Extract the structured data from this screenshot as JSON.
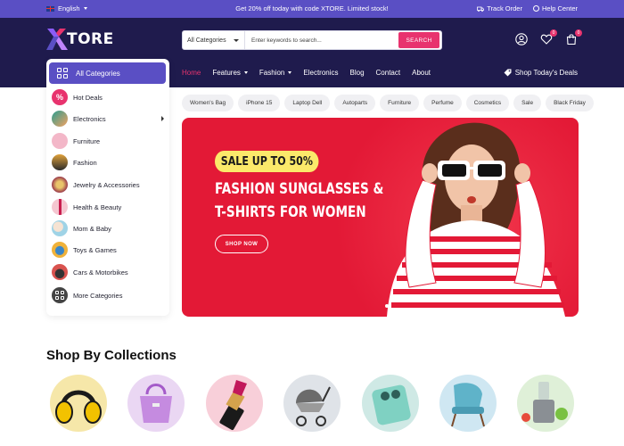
{
  "topbar": {
    "language": "English",
    "promo": "Get 20% off today with code XTORE. Limited stock!",
    "track_order": "Track Order",
    "help_center": "Help Center"
  },
  "header": {
    "logo_text": "TORE",
    "search": {
      "category": "All Categories",
      "placeholder": "Enter keywords to search...",
      "button": "SEARCH"
    },
    "icons": [
      {
        "name": "account-icon"
      },
      {
        "name": "wishlist-icon",
        "badge": "0"
      },
      {
        "name": "cart-icon",
        "badge": "0"
      }
    ]
  },
  "nav": {
    "items": [
      {
        "label": "Home",
        "active": true
      },
      {
        "label": "Features",
        "dropdown": true
      },
      {
        "label": "Fashion",
        "dropdown": true
      },
      {
        "label": "Electronics"
      },
      {
        "label": "Blog"
      },
      {
        "label": "Contact"
      },
      {
        "label": "About"
      }
    ],
    "deals": "Shop Today's Deals"
  },
  "sidebar": {
    "all_categories": "All Categories",
    "items": [
      {
        "label": "Hot Deals",
        "color": "#e8336e"
      },
      {
        "label": "Electronics",
        "color": "#2a9d8f",
        "has_submenu": true
      },
      {
        "label": "Furniture",
        "color": "#f3b7c8"
      },
      {
        "label": "Fashion",
        "color": "#e0a13a"
      },
      {
        "label": "Jewelry & Accessories",
        "color": "#9b3a4a"
      },
      {
        "label": "Health & Beauty",
        "color": "#f5c6d0"
      },
      {
        "label": "Mom & Baby",
        "color": "#9fd3e6"
      },
      {
        "label": "Toys & Games",
        "color": "#f0b23a"
      },
      {
        "label": "Cars & Motorbikes",
        "color": "#d9534f"
      }
    ],
    "more": "More Categories"
  },
  "tags": [
    "Women's Bag",
    "iPhone 15",
    "Laptop Dell",
    "Autoparts",
    "Furniture",
    "Perfume",
    "Cosmetics",
    "Sale",
    "Black Friday"
  ],
  "banner": {
    "pill": "SALE UP TO 50%",
    "line1": "FASHION SUNGLASSES &",
    "line2": "T-SHIRTS FOR WOMEN",
    "button": "SHOP NOW",
    "background": "#e31936"
  },
  "collections": {
    "title": "Shop By Collections",
    "items": [
      {
        "name": "headphones",
        "bg": "#f6e7a9"
      },
      {
        "name": "handbag",
        "bg": "#ead7f3"
      },
      {
        "name": "lipstick",
        "bg": "#f8cfd9"
      },
      {
        "name": "stroller",
        "bg": "#dfe3e8"
      },
      {
        "name": "smartphone",
        "bg": "#cfe9e5"
      },
      {
        "name": "armchair",
        "bg": "#cfe7f2"
      },
      {
        "name": "juicer",
        "bg": "#dff0d8"
      }
    ]
  }
}
